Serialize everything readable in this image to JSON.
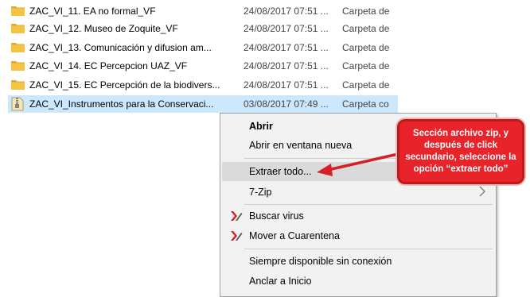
{
  "files": [
    {
      "name": "ZAC_VI_11. EA no formal_VF",
      "date": "24/08/2017 07:51 ...",
      "type": "Carpeta de",
      "icon": "folder-icon"
    },
    {
      "name": "ZAC_VI_12. Museo de Zoquite_VF",
      "date": "24/08/2017 07:51 ...",
      "type": "Carpeta de",
      "icon": "folder-icon"
    },
    {
      "name": "ZAC_VI_13. Comunicación y difusion am...",
      "date": "24/08/2017 07:51 ...",
      "type": "Carpeta de",
      "icon": "folder-icon"
    },
    {
      "name": "ZAC_VI_14. EC Percepcion UAZ_VF",
      "date": "24/08/2017 07:51 ...",
      "type": "Carpeta de",
      "icon": "folder-icon"
    },
    {
      "name": "ZAC_VI_15. EC Percepción de la biodivers...",
      "date": "24/08/2017 07:51 ...",
      "type": "Carpeta de",
      "icon": "folder-icon"
    },
    {
      "name": "ZAC_VI_Instrumentos para la Conservaci...",
      "date": "03/08/2017 07:49 ...",
      "type": "Carpeta co",
      "icon": "zip-folder-icon"
    }
  ],
  "context_menu": {
    "open": "Abrir",
    "open_new_window": "Abrir en ventana nueva",
    "extract_all": "Extraer todo...",
    "seven_zip": "7-Zip",
    "scan_virus": "Buscar virus",
    "move_quarantine": "Mover a Cuarentena",
    "always_offline": "Siempre disponible sin conexión",
    "pin_start": "Anclar a Inicio"
  },
  "callout": {
    "text": "Sección archivo zip, y después de click secundario, seleccione la opción “extraer todo”"
  },
  "colors": {
    "selection": "#cce8ff",
    "menu_bg": "#f2f2f2",
    "callout_red": "#e8232a",
    "folder_yellow": "#f5c342"
  }
}
